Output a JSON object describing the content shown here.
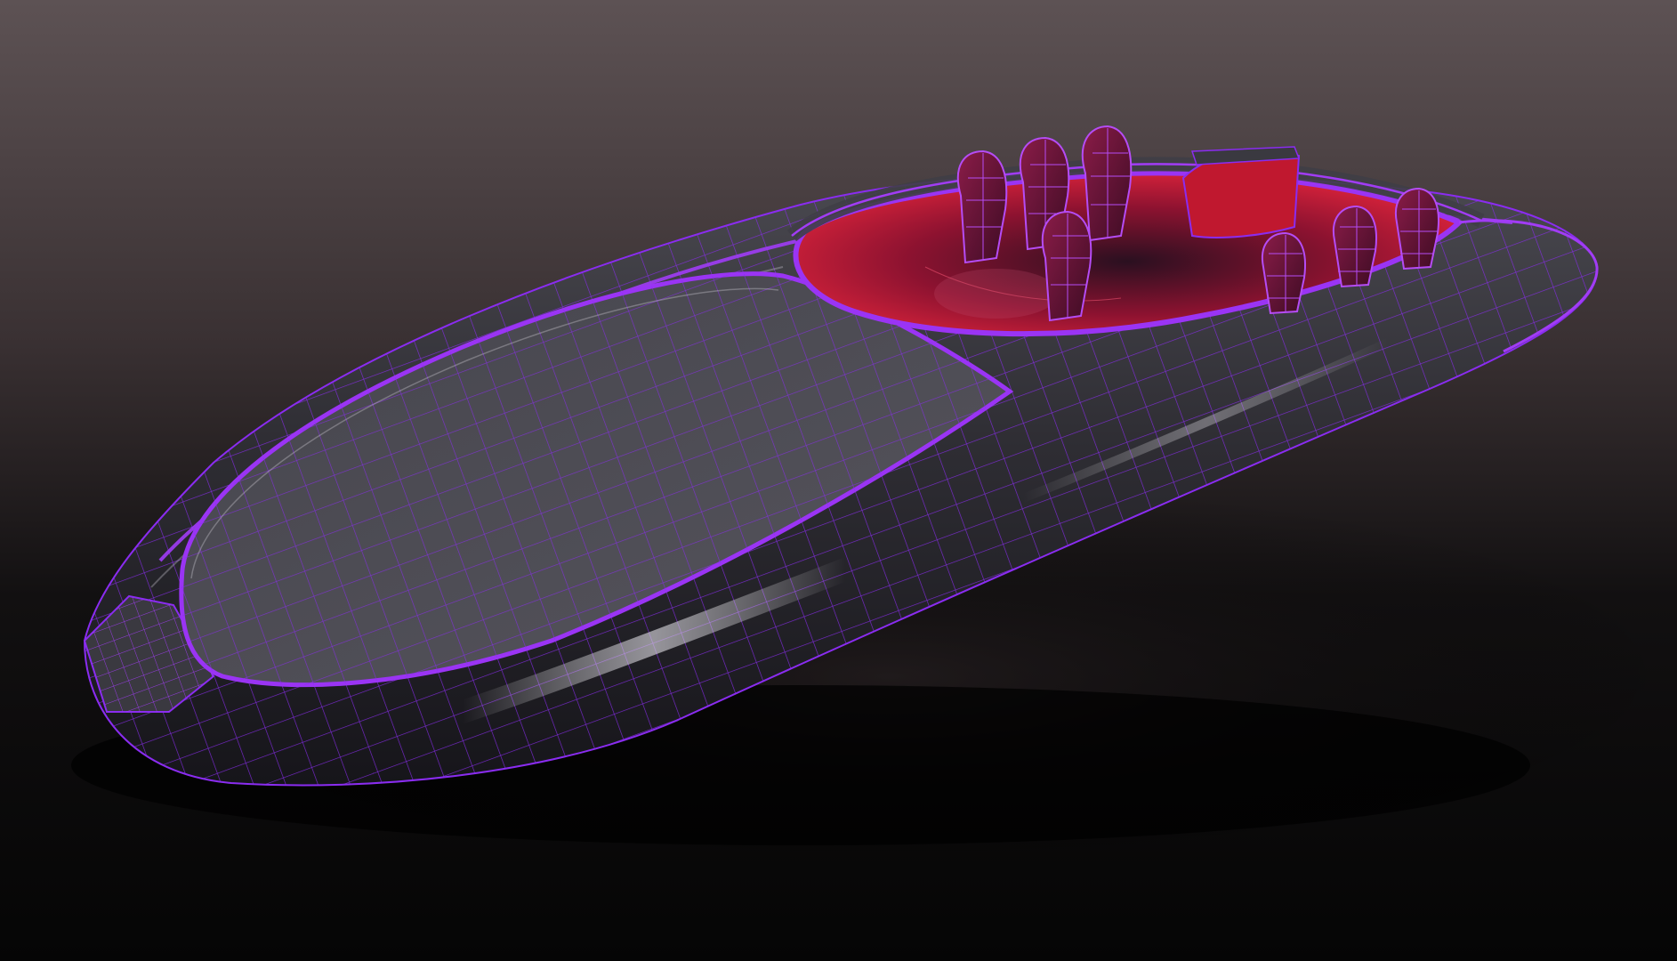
{
  "scene": {
    "subject": "boat-hull-wireframe-render",
    "colors": {
      "background_top": "#5d5254",
      "background_bottom": "#050505",
      "hull": "#3c3b42",
      "hull_highlight": "#b9b7be",
      "wire": "#8a2cf0",
      "cockpit_interior": "#e0243c",
      "seat": "#6a1436"
    },
    "seats_visible": 7
  }
}
